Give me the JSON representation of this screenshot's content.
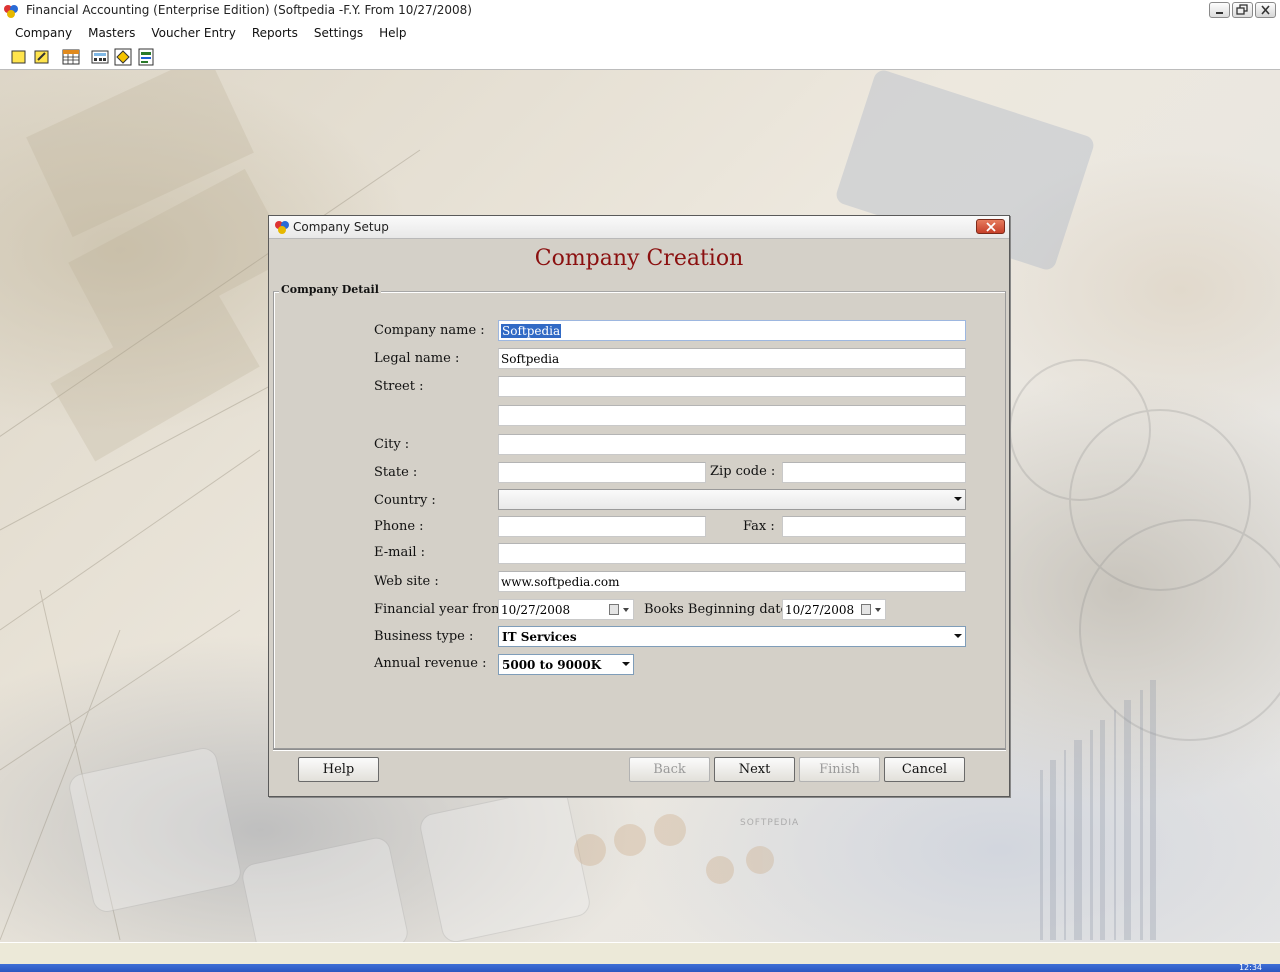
{
  "app": {
    "title": "Financial Accounting (Enterprise Edition) (Softpedia -F.Y. From 10/27/2008)"
  },
  "menu": [
    "Company",
    "Masters",
    "Voucher Entry",
    "Reports",
    "Settings",
    "Help"
  ],
  "toolbar": {
    "icons": [
      "new-company-icon",
      "open-company-icon",
      "table-icon",
      "calculator-icon",
      "diamond-tool-icon",
      "report-icon"
    ]
  },
  "dialog": {
    "title": "Company Setup",
    "heading": "Company Creation",
    "group_label": "Company Detail",
    "labels": {
      "company_name": "Company name :",
      "legal_name": "Legal name :",
      "street": "Street :",
      "city": "City :",
      "state": "State :",
      "zip": "Zip code :",
      "country": "Country :",
      "phone": "Phone :",
      "fax": "Fax :",
      "email": "E-mail :",
      "website": "Web site :",
      "fy_from": "Financial year from :",
      "books_beginning": "Books Beginning date:",
      "business_type": "Business type :",
      "annual_revenue": "Annual revenue :"
    },
    "values": {
      "company_name": "Softpedia",
      "legal_name": "Softpedia",
      "street1": "",
      "street2": "",
      "city": "",
      "state": "",
      "zip": "",
      "country": "",
      "phone": "",
      "fax": "",
      "email": "",
      "website": "www.softpedia.com",
      "fy_from": "10/27/2008",
      "books_beginning": "10/27/2008",
      "business_type": "IT Services",
      "annual_revenue": "5000 to 9000K"
    },
    "buttons": {
      "help": "Help",
      "back": "Back",
      "next": "Next",
      "finish": "Finish",
      "cancel": "Cancel"
    }
  },
  "watermark": "SOFTPEDIA",
  "clock": "12:34",
  "colors": {
    "heading": "#8b1010",
    "selection": "#316ac5",
    "dialog_bg": "#d4d0c8",
    "close_button": "#c6402a"
  }
}
